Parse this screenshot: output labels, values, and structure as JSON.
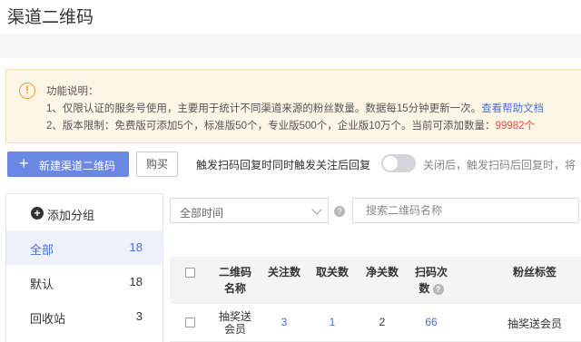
{
  "page": {
    "title": "渠道二维码"
  },
  "notice": {
    "icon": "exclamation-circle-icon",
    "heading": "功能说明：",
    "line1_text": "1、仅限认证的服务号使用，主要用于统计不同渠道来源的粉丝数量。数据每15分钟更新一次。",
    "line1_link": "查看帮助文档",
    "line2_text": "2、版本限制：免费版可添加5个，标准版50个，专业版500个，企业版10万个。当前可添加数量：",
    "line2_count": "99982个"
  },
  "toolbar": {
    "new_button": "新建渠道二维码",
    "new_icon": "plus-icon",
    "buy_button": "购买",
    "trigger_label": "触发扫码回复时同时触发关注后回复",
    "toggle_on": false,
    "trigger_hint": "关闭后，触发扫码后回复时，将"
  },
  "sidebar": {
    "add_group": "添加分组",
    "add_icon": "plus-circle-icon",
    "groups": [
      {
        "name": "全部",
        "count": "18"
      },
      {
        "name": "默认",
        "count": "18"
      },
      {
        "name": "回收站",
        "count": "3"
      }
    ]
  },
  "filters": {
    "time_value": "全部时间",
    "search_placeholder": "搜索二维码名称"
  },
  "table": {
    "headers": {
      "name_l1": "二维码",
      "name_l2": "名称",
      "follow": "关注数",
      "unfollow": "取关数",
      "net": "净关数",
      "scan_l1": "扫码次",
      "scan_l2": "数",
      "tags": "粉丝标签"
    },
    "rows": [
      {
        "name_l1": "抽奖送",
        "name_l2": "会员",
        "follow": "3",
        "unfollow": "1",
        "net": "2",
        "scan": "66",
        "tags": "抽奖送会员"
      }
    ]
  },
  "colors": {
    "accent": "#6a87e3",
    "link": "#4a6fd1",
    "warning": "#f0a020",
    "highlight": "#e04a3a"
  }
}
